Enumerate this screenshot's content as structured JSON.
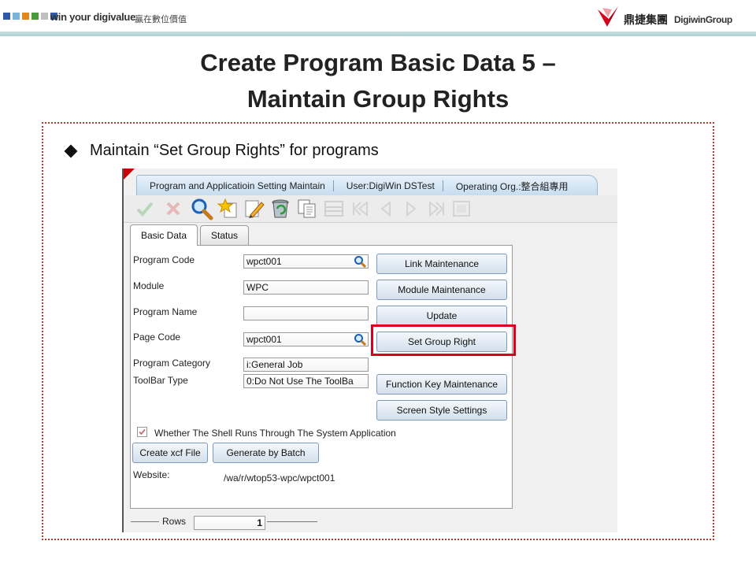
{
  "banner": {
    "slogan": "win your digivalue",
    "slogan_cn": "贏在數位價值",
    "group_cn": "鼎捷集團",
    "group_en": "DigiwinGroup"
  },
  "title": {
    "line1": "Create Program Basic Data 5 –",
    "line2": "Maintain Group Rights"
  },
  "bullet": "Maintain “Set Group Rights” for programs",
  "app": {
    "header_tabs": [
      "Program and Applicatioin Setting Maintain",
      "User:DigiWin DSTest",
      "Operating Org.:整合組專用"
    ],
    "tabs": [
      "Basic Data",
      "Status"
    ],
    "fields": {
      "program_code_label": "Program Code",
      "program_code_value": "wpct001",
      "module_label": "Module",
      "module_value": "WPC",
      "program_name_label": "Program Name",
      "program_name_value": "",
      "page_code_label": "Page Code",
      "page_code_value": "wpct001",
      "program_category_label": "Program Category",
      "program_category_value": "i:General Job",
      "toolbar_type_label": "ToolBar Type",
      "toolbar_type_value": "0:Do Not Use The ToolBa"
    },
    "buttons": {
      "link_maintenance": "Link Maintenance",
      "module_maintenance": "Module Maintenance",
      "update": "Update",
      "set_group_right": "Set Group Right",
      "function_key_maintenance": "Function Key Maintenance",
      "screen_style_settings": "Screen Style Settings",
      "create_xcf_file": "Create xcf File",
      "generate_by_batch": "Generate by Batch"
    },
    "shell_checkbox_label": "Whether The Shell Runs Through The System Application",
    "shell_checked": true,
    "website_label": "Website:",
    "website_value": "/wa/r/wtop53-wpc/wpct001",
    "rows_label": "Rows",
    "rows_value": "1"
  },
  "colors": {
    "frame": "#c0392b",
    "highlight": "#d9001b",
    "button_border": "#7c9ab8"
  }
}
